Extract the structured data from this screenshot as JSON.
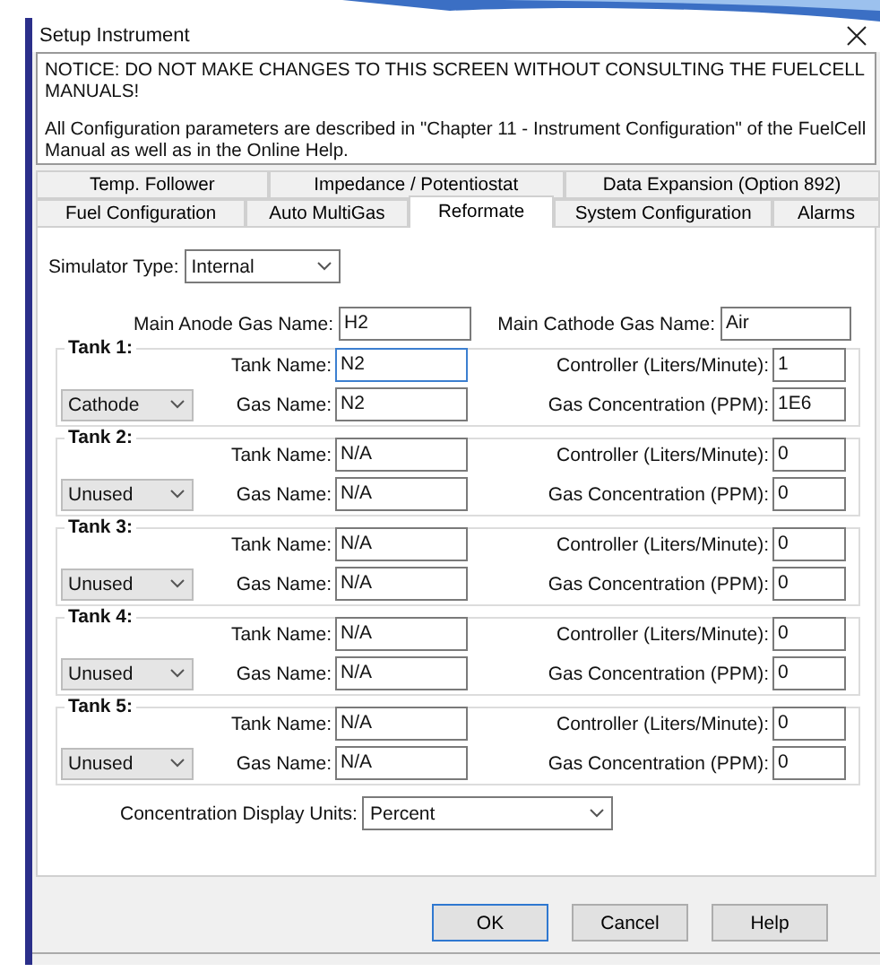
{
  "window": {
    "title": "Setup Instrument"
  },
  "notice": {
    "warning": "NOTICE:  DO NOT MAKE CHANGES TO THIS SCREEN WITHOUT CONSULTING THE FUELCELL MANUALS!",
    "info": "All Configuration parameters are described in \"Chapter 11 - Instrument Configuration\" of the FuelCell Manual as well as in the Online Help."
  },
  "tab_rows": [
    {
      "tabs": [
        {
          "label": "Temp. Follower",
          "selected": false
        },
        {
          "label": "Impedance / Potentiostat",
          "selected": false
        },
        {
          "label": "Data Expansion (Option 892)",
          "selected": false
        }
      ]
    },
    {
      "tabs": [
        {
          "label": "Fuel Configuration",
          "selected": false
        },
        {
          "label": "Auto MultiGas",
          "selected": false
        },
        {
          "label": "Reformate",
          "selected": true
        },
        {
          "label": "System Configuration",
          "selected": false
        },
        {
          "label": "Alarms",
          "selected": false
        }
      ]
    }
  ],
  "simulator_type": {
    "label": "Simulator Type:",
    "value": "Internal"
  },
  "main_gases": [
    {
      "label": "Main Anode Gas Name:",
      "value": "H2"
    },
    {
      "label": "Main Cathode Gas Name:",
      "value": "Air"
    }
  ],
  "tanks": [
    {
      "title": "Tank 1:",
      "usage": "Cathode",
      "fields": [
        {
          "label": "Tank Name:",
          "value": "N2",
          "focused": true
        },
        {
          "label": "Controller (Liters/Minute):",
          "value": "1",
          "focused": false
        },
        {
          "label": "Gas Name:",
          "value": "N2",
          "focused": false
        },
        {
          "label": "Gas Concentration (PPM):",
          "value": "1E6",
          "focused": false
        }
      ]
    },
    {
      "title": "Tank 2:",
      "usage": "Unused",
      "fields": [
        {
          "label": "Tank Name:",
          "value": "N/A",
          "focused": false
        },
        {
          "label": "Controller (Liters/Minute):",
          "value": "0",
          "focused": false
        },
        {
          "label": "Gas Name:",
          "value": "N/A",
          "focused": false
        },
        {
          "label": "Gas Concentration (PPM):",
          "value": "0",
          "focused": false
        }
      ]
    },
    {
      "title": "Tank 3:",
      "usage": "Unused",
      "fields": [
        {
          "label": "Tank Name:",
          "value": "N/A",
          "focused": false
        },
        {
          "label": "Controller (Liters/Minute):",
          "value": "0",
          "focused": false
        },
        {
          "label": "Gas Name:",
          "value": "N/A",
          "focused": false
        },
        {
          "label": "Gas Concentration (PPM):",
          "value": "0",
          "focused": false
        }
      ]
    },
    {
      "title": "Tank 4:",
      "usage": "Unused",
      "fields": [
        {
          "label": "Tank Name:",
          "value": "N/A",
          "focused": false
        },
        {
          "label": "Controller (Liters/Minute):",
          "value": "0",
          "focused": false
        },
        {
          "label": "Gas Name:",
          "value": "N/A",
          "focused": false
        },
        {
          "label": "Gas Concentration (PPM):",
          "value": "0",
          "focused": false
        }
      ]
    },
    {
      "title": "Tank 5:",
      "usage": "Unused",
      "fields": [
        {
          "label": "Tank Name:",
          "value": "N/A",
          "focused": false
        },
        {
          "label": "Controller (Liters/Minute):",
          "value": "0",
          "focused": false
        },
        {
          "label": "Gas Name:",
          "value": "N/A",
          "focused": false
        },
        {
          "label": "Gas Concentration (PPM):",
          "value": "0",
          "focused": false
        }
      ]
    }
  ],
  "display_units": {
    "label": "Concentration Display Units:",
    "value": "Percent"
  },
  "buttons": [
    {
      "label": "OK",
      "default": true
    },
    {
      "label": "Cancel",
      "default": false
    },
    {
      "label": "Help",
      "default": false
    }
  ]
}
